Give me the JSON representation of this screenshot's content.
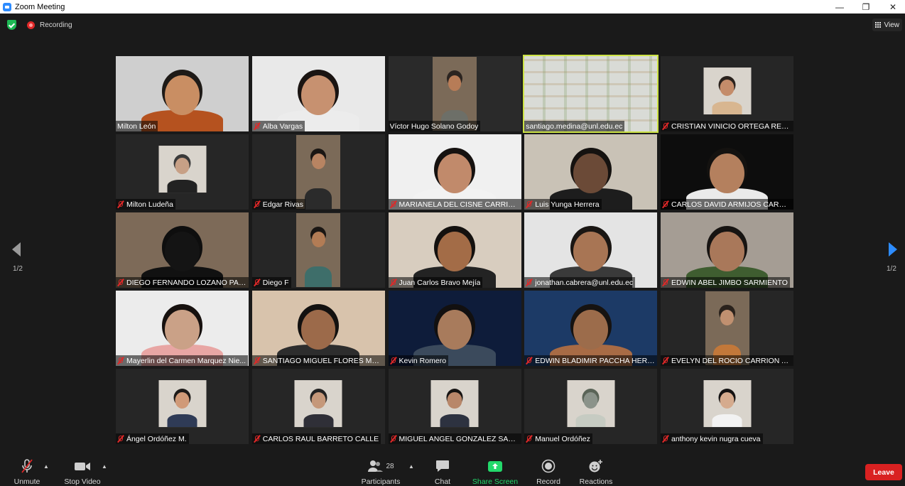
{
  "window": {
    "title": "Zoom Meeting",
    "minimize_glyph": "—",
    "restore_glyph": "❐",
    "close_glyph": "✕"
  },
  "topbar": {
    "recording_label": "Recording",
    "view_label": "View"
  },
  "gallery": {
    "page_indicator": "1/2",
    "tiles": [
      {
        "name": "Milton León",
        "muted": false,
        "bg": "#cfcfcf",
        "skin": "#c98e63",
        "hair": "#1e1a17",
        "shirt": "#b5521f",
        "style": "full"
      },
      {
        "name": "Alba Vargas",
        "muted": true,
        "bg": "#e9e9e9",
        "skin": "#c79170",
        "hair": "#1a1412",
        "shirt": "#ececec",
        "style": "full"
      },
      {
        "name": "Víctor Hugo Solano Godoy",
        "muted": false,
        "bg": "#2a2a2a",
        "skin": "#b77c57",
        "hair": "#2b2420",
        "shirt": "#6d6f68",
        "style": "boxed"
      },
      {
        "name": "santiago.medina@unl.edu.ec",
        "muted": false,
        "bg": "#d9dbd6",
        "skin": "",
        "hair": "",
        "shirt": "",
        "style": "empty",
        "active": true
      },
      {
        "name": "CRISTIAN VINICIO ORTEGA REYES",
        "muted": true,
        "bg": "#262626",
        "skin": "#c48c6a",
        "hair": "#2a221d",
        "shirt": "#d8b690",
        "style": "small"
      },
      {
        "name": "Milton Ludeña",
        "muted": true,
        "bg": "#262626",
        "skin": "#c7a086",
        "hair": "#3a3a3a",
        "shirt": "#222222",
        "style": "small"
      },
      {
        "name": "Edgar Rivas",
        "muted": true,
        "bg": "#262626",
        "skin": "#b88462",
        "hair": "#1a1613",
        "shirt": "#2b2b2b",
        "style": "boxed"
      },
      {
        "name": "MARIANELA DEL CISNE CARRION...",
        "muted": true,
        "bg": "#f0f0f0",
        "skin": "#c18a6b",
        "hair": "#161210",
        "shirt": "#f2f2f2",
        "style": "full"
      },
      {
        "name": "Luis Yunga Herrera",
        "muted": true,
        "bg": "#c9c2b6",
        "skin": "#6b4a37",
        "hair": "#151210",
        "shirt": "#1d1d1d",
        "style": "full"
      },
      {
        "name": "CARLOS DAVID ARMIJOS CARRION",
        "muted": true,
        "bg": "#0d0d0d",
        "skin": "#b4805e",
        "hair": "#141210",
        "shirt": "#eaeaea",
        "style": "full"
      },
      {
        "name": "DIEGO FERNANDO LOZANO PARE...",
        "muted": true,
        "bg": "#7d6a58",
        "skin": "#141414",
        "hair": "#0e0e0e",
        "shirt": "#111111",
        "style": "full"
      },
      {
        "name": "Diego F",
        "muted": true,
        "bg": "#262626",
        "skin": "#b27c55",
        "hair": "#1a1613",
        "shirt": "#3e6e6a",
        "style": "boxed"
      },
      {
        "name": "Juan Carlos Bravo Mejía",
        "muted": true,
        "bg": "#d8cdbf",
        "skin": "#a36c47",
        "hair": "#14110f",
        "shirt": "#232323",
        "style": "full"
      },
      {
        "name": "jonathan.cabrera@unl.edu.ec",
        "muted": true,
        "bg": "#e4e4e4",
        "skin": "#a87554",
        "hair": "#1a1613",
        "shirt": "#3a3a3a",
        "style": "full"
      },
      {
        "name": "EDWIN ABEL JIMBO SARMIENTO",
        "muted": true,
        "bg": "#a59d94",
        "skin": "#a9785a",
        "hair": "#171412",
        "shirt": "#3f5d30",
        "style": "full"
      },
      {
        "name": "Mayerlin del Carmen Marquez Nie...",
        "muted": true,
        "bg": "#ececec",
        "skin": "#caa187",
        "hair": "#17110f",
        "shirt": "#e8a6a4",
        "style": "full"
      },
      {
        "name": "SANTIAGO MIGUEL FLORES MEDI...",
        "muted": true,
        "bg": "#d8c3ac",
        "skin": "#9c6a4a",
        "hair": "#131110",
        "shirt": "#2d2d2d",
        "style": "full"
      },
      {
        "name": "Kevin Romero",
        "muted": true,
        "bg": "#0e1c3a",
        "skin": "#a87b5c",
        "hair": "#121010",
        "shirt": "#3b4a5c",
        "style": "full"
      },
      {
        "name": "EDWIN BLADIMIR PACCHA HERRE...",
        "muted": true,
        "bg": "#1c3a66",
        "skin": "#9c6c4b",
        "hair": "#161311",
        "shirt": "#a86b45",
        "style": "full"
      },
      {
        "name": "EVELYN DEL ROCIO CARRION AG...",
        "muted": true,
        "bg": "#262626",
        "skin": "#c09070",
        "hair": "#2a221c",
        "shirt": "#c2783a",
        "style": "boxed"
      },
      {
        "name": "Ángel Ordóñez M.",
        "muted": true,
        "bg": "#262626",
        "skin": "#d09a78",
        "hair": "#1d1a18",
        "shirt": "#2f3b56",
        "style": "small"
      },
      {
        "name": "CARLOS RAUL BARRETO CALLE",
        "muted": true,
        "bg": "#262626",
        "skin": "#c5987a",
        "hair": "#222222",
        "shirt": "#2f2f37",
        "style": "small"
      },
      {
        "name": "MIGUEL ANGEL GONZALEZ SAMA...",
        "muted": true,
        "bg": "#262626",
        "skin": "#b8876a",
        "hair": "#151312",
        "shirt": "#2d3240",
        "style": "small"
      },
      {
        "name": "Manuel Ordóñez",
        "muted": true,
        "bg": "#262626",
        "skin": "#8b938a",
        "hair": "#5a6457",
        "shirt": "#c6cbc2",
        "style": "small"
      },
      {
        "name": "anthony kevin nugra cueva",
        "muted": true,
        "bg": "#262626",
        "skin": "#d5ab8e",
        "hair": "#141212",
        "shirt": "#f2f2f2",
        "style": "small"
      }
    ]
  },
  "toolbar": {
    "unmute": "Unmute",
    "stop_video": "Stop Video",
    "participants": "Participants",
    "participants_count": "28",
    "chat": "Chat",
    "share_screen": "Share Screen",
    "record": "Record",
    "reactions": "Reactions",
    "leave": "Leave",
    "accent_green": "#23d96b",
    "leave_red": "#d92121"
  }
}
